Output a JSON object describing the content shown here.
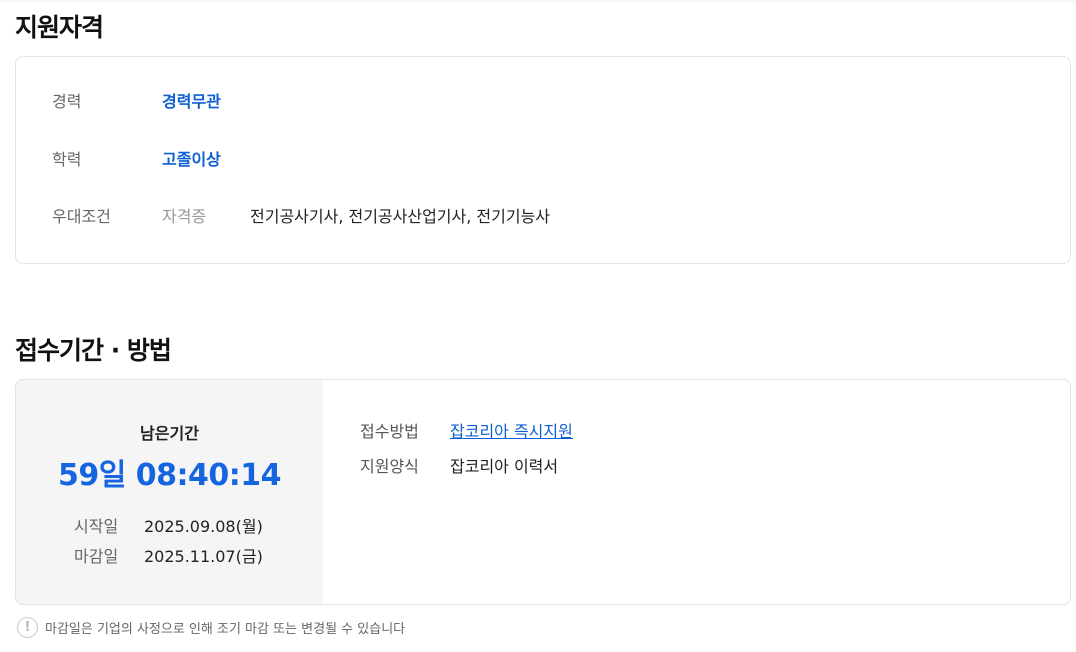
{
  "qualifications": {
    "title": "지원자격",
    "experience": {
      "label": "경력",
      "value": "경력무관"
    },
    "education": {
      "label": "학력",
      "value": "고졸이상"
    },
    "preference": {
      "label": "우대조건",
      "sub_label": "자격증",
      "value": "전기공사기사, 전기공사산업기사, 전기기능사"
    }
  },
  "application": {
    "title": "접수기간 · 방법",
    "remaining_label": "남은기간",
    "remaining_time": "59일 08:40:14",
    "start_label": "시작일",
    "start_date": "2025.09.08(월)",
    "end_label": "마감일",
    "end_date": "2025.11.07(금)",
    "method_label": "접수방법",
    "method_value": "잡코리아 즉시지원",
    "form_label": "지원양식",
    "form_value": "잡코리아 이력서"
  },
  "notice": {
    "icon": "exclamation-circle-icon",
    "icon_glyph": "!",
    "text": "마감일은 기업의 사정으로 인해 조기 마감 또는 변경될 수 있습니다"
  },
  "colors": {
    "accent": "#0d5fd3",
    "timer": "#1565e0",
    "panel_bg": "#f5f5f5",
    "border": "#e3e3e3"
  }
}
